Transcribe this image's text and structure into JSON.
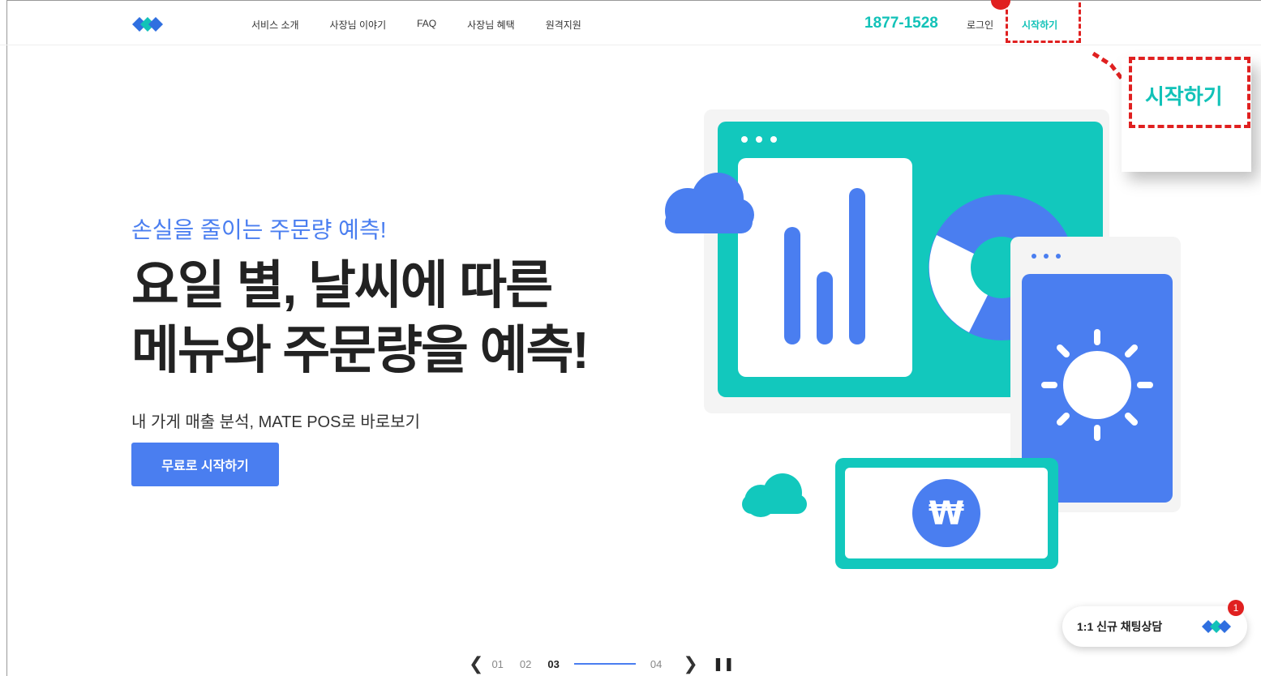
{
  "nav": {
    "items": [
      "서비스 소개",
      "사장님 이야기",
      "FAQ",
      "사장님 혜택",
      "원격지원"
    ]
  },
  "header": {
    "phone": "1877-1528",
    "login": "로그인",
    "start": "시작하기"
  },
  "callout": {
    "text": "시작하기"
  },
  "hero": {
    "subtitle": "손실을 줄이는 주문량 예측!",
    "title_line1": "요일 별, 날씨에 따른",
    "title_line2": "메뉴와 주문량을 예측!",
    "description": "내 가게 매출 분석, MATE POS로 바로보기",
    "cta": "무료로 시작하기"
  },
  "slider": {
    "prev_icon": "chevron-left-icon",
    "pages": [
      "01",
      "02",
      "03",
      "04"
    ],
    "current": "03",
    "next_icon": "chevron-right-icon",
    "pause_icon": "pause-icon"
  },
  "chat": {
    "label": "1:1 신규 채팅상담",
    "badge": "1"
  },
  "colors": {
    "accent": "#12c2b8",
    "primary": "#4a7ef0",
    "highlight": "#e02020"
  }
}
